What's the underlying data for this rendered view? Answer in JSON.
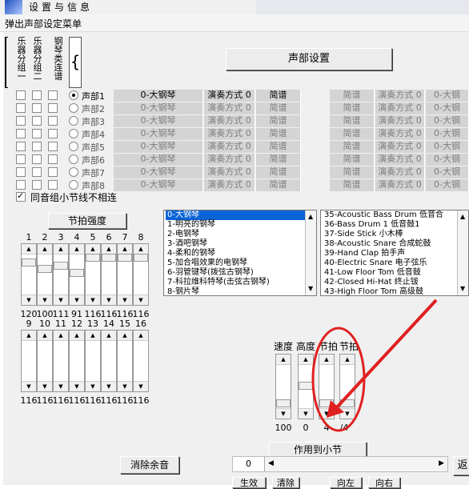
{
  "window": {
    "title": "设置与信息"
  },
  "menu": {
    "popup_label": "弹出声部设定菜单"
  },
  "vtabs": [
    "乐器分组一",
    "乐器分组二",
    "钢琴类连谱"
  ],
  "part_setting_button": "声部设置",
  "parts": [
    {
      "label": "声部1",
      "instrument": "0-大钢琴",
      "mode": "演奏方式 0",
      "score": "简谱",
      "selected": true
    },
    {
      "label": "声部2",
      "instrument": "0-大钢琴",
      "mode": "演奏方式 0",
      "score": "简谱",
      "selected": false
    },
    {
      "label": "声部3",
      "instrument": "0-大钢琴",
      "mode": "演奏方式 0",
      "score": "简谱",
      "selected": false
    },
    {
      "label": "声部4",
      "instrument": "0-大钢琴",
      "mode": "演奏方式 0",
      "score": "简谱",
      "selected": false
    },
    {
      "label": "声部5",
      "instrument": "0-大钢琴",
      "mode": "演奏方式 0",
      "score": "简谱",
      "selected": false
    },
    {
      "label": "声部6",
      "instrument": "0-大钢琴",
      "mode": "演奏方式 0",
      "score": "简谱",
      "selected": false
    },
    {
      "label": "声部7",
      "instrument": "0-大钢琴",
      "mode": "演奏方式 0",
      "score": "简谱",
      "selected": false
    },
    {
      "label": "声部8",
      "instrument": "0-大钢琴",
      "mode": "演奏方式 0",
      "score": "简谱",
      "selected": false
    }
  ],
  "right_parts": [
    {
      "score": "简谱",
      "mode": "演奏方式 0",
      "instrument": "0-大钢"
    },
    {
      "score": "简谱",
      "mode": "演奏方式 0",
      "instrument": "0-大钢"
    },
    {
      "score": "简谱",
      "mode": "演奏方式 0",
      "instrument": "0-大钢"
    },
    {
      "score": "简谱",
      "mode": "演奏方式 0",
      "instrument": "0-大钢"
    },
    {
      "score": "简谱",
      "mode": "演奏方式 0",
      "instrument": "0-大钢"
    },
    {
      "score": "简谱",
      "mode": "演奏方式 0",
      "instrument": "0-大钢"
    },
    {
      "score": "简谱",
      "mode": "演奏方式 0",
      "instrument": "0-大钢"
    },
    {
      "score": "简谱",
      "mode": "演奏方式 0",
      "instrument": "0-大钢"
    }
  ],
  "same_group_check": "同音组小节线不相连",
  "beat_strength_button": "节拍强度",
  "beat_numbers_top": [
    "1",
    "2",
    "3",
    "4",
    "5",
    "6",
    "7",
    "8"
  ],
  "beat_values_top": [
    "120",
    "100",
    "111",
    "91",
    "116",
    "116",
    "116",
    "116"
  ],
  "beat_levels_top": [
    0.12,
    0.27,
    0.2,
    0.37,
    0.0,
    0.0,
    0.0,
    0.0
  ],
  "beat_numbers_bottom": [
    "9",
    "10",
    "11",
    "12",
    "13",
    "14",
    "15",
    "16"
  ],
  "beat_values_bottom": [
    "116",
    "116",
    "116",
    "116",
    "116",
    "116",
    "116",
    "116"
  ],
  "instruments_list": [
    "0-大钢琴",
    "1-明亮的钢琴",
    "2-电钢琴",
    "3-酒吧钢琴",
    "4-柔和的钢琴",
    "5-加合唱效果的电钢琴",
    "6-羽管键琴(拨弦古钢琴)",
    "7-科拉维科特琴(击弦古钢琴)",
    "8-钢片琴"
  ],
  "drums_list": [
    "35-Acoustic Bass Drum  低音合",
    "36-Bass Drum 1 低音鼓1",
    "37-Side Stick 小木棒",
    "38-Acoustic Snare 合成蛇鼓",
    "39-Hand Clap 拍手声",
    "40-Electric Snare 电子弦乐",
    "41-Low Floor Tom 低音鼓",
    "42-Closed Hi-Hat 终止钹",
    "43-High Floor Tom 高级鼓"
  ],
  "controls": {
    "speed_label": "速度",
    "height_label": "高度",
    "beat_label_1": "节拍",
    "beat_label_2": "节拍",
    "speed_value": "100",
    "height_value": "0",
    "beat_value_1": "4",
    "beat_value_2": "/4"
  },
  "apply_button": "作用到小节",
  "clear_button": "消除余音",
  "position_value": "0",
  "bottom_buttons": [
    "生效",
    "清除",
    "向左",
    "向右"
  ],
  "back_button": "返",
  "colors": {
    "selection": "#0a64d8",
    "annotation": "#e02020",
    "panel": "#f0f0f0"
  }
}
